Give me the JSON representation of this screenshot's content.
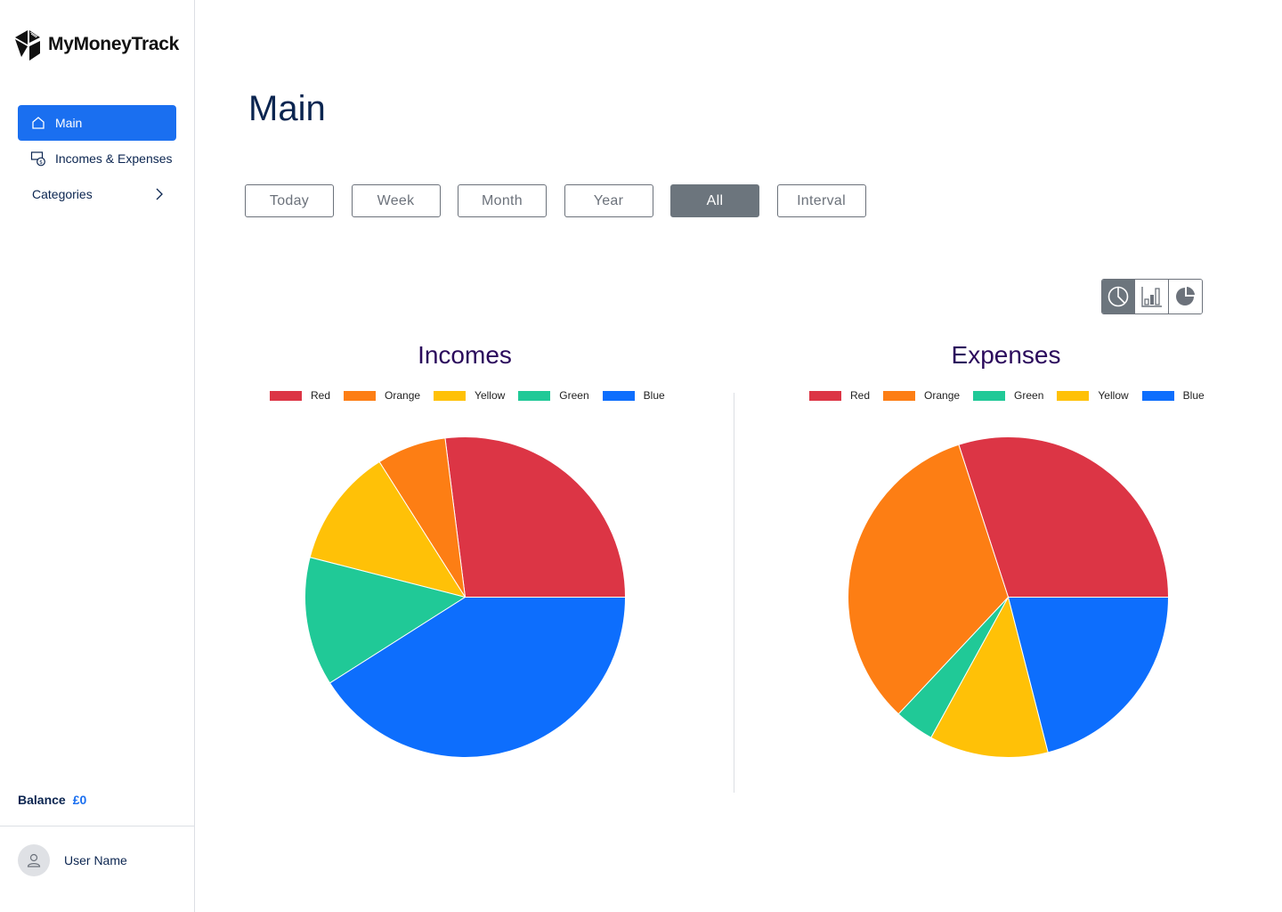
{
  "app": {
    "name": "MyMoneyTrack"
  },
  "sidebar": {
    "items": [
      {
        "label": "Main",
        "icon": "home-icon",
        "active": true
      },
      {
        "label": "Incomes & Expenses",
        "icon": "money-exchange-icon",
        "active": false
      },
      {
        "label": "Categories",
        "icon": "chevron-right-icon",
        "active": false
      }
    ],
    "balance_label": "Balance",
    "balance_value": "£0",
    "user_name": "User Name"
  },
  "main": {
    "title": "Main",
    "filters": [
      {
        "label": "Today",
        "active": false
      },
      {
        "label": "Week",
        "active": false
      },
      {
        "label": "Month",
        "active": false
      },
      {
        "label": "Year",
        "active": false
      },
      {
        "label": "All",
        "active": true
      },
      {
        "label": "Interval",
        "active": false
      }
    ],
    "chart_switch": [
      {
        "icon": "pie-chart-outline-icon",
        "active": true
      },
      {
        "icon": "bar-chart-icon",
        "active": false
      },
      {
        "icon": "pie-chart-filled-icon",
        "active": false
      }
    ]
  },
  "colors": {
    "accent": "#1a6ff0",
    "Red": "#dc3545",
    "Orange": "#fd7e14",
    "Yellow": "#ffc107",
    "Green": "#20c997",
    "Blue": "#0d6efd"
  },
  "chart_data": [
    {
      "type": "pie",
      "title": "Incomes",
      "legend_position": "top",
      "labels": [
        "Red",
        "Orange",
        "Yellow",
        "Green",
        "Blue"
      ],
      "values": [
        27,
        7,
        12,
        13,
        41
      ]
    },
    {
      "type": "pie",
      "title": "Expenses",
      "legend_position": "top",
      "labels": [
        "Red",
        "Orange",
        "Green",
        "Yellow",
        "Blue"
      ],
      "values": [
        30,
        33,
        4,
        12,
        21
      ]
    }
  ]
}
